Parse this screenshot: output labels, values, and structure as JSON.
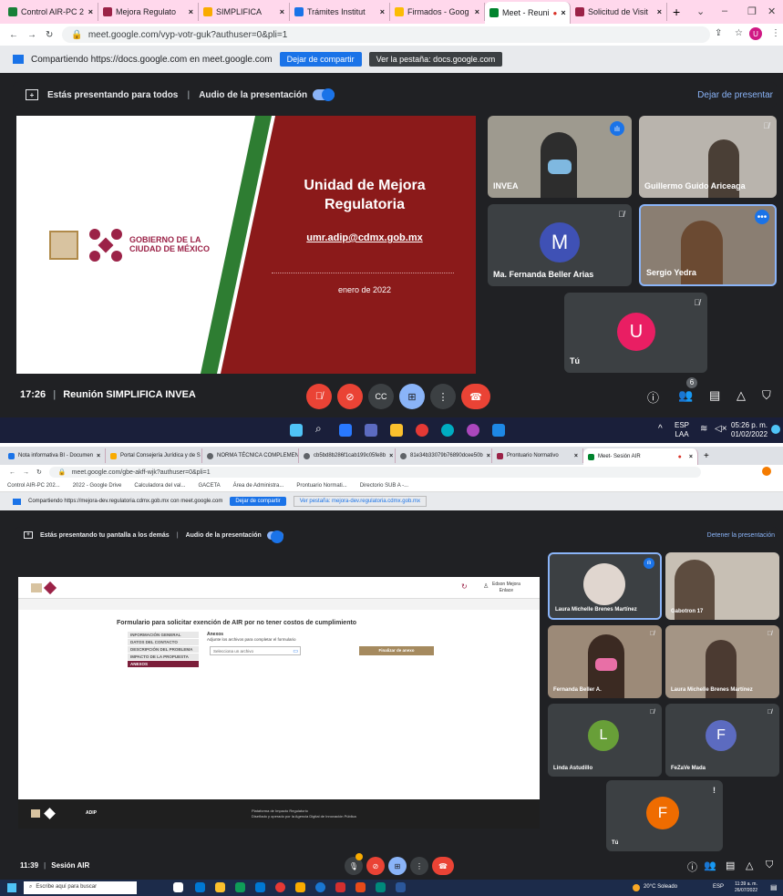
{
  "s1": {
    "tabs": [
      {
        "label": "Control AIR-PC 2",
        "color": "#188038"
      },
      {
        "label": "Mejora Regulato",
        "color": "#9b2247"
      },
      {
        "label": "SIMPLIFICA",
        "color": "#f9ab00"
      },
      {
        "label": "Trámites Institut",
        "color": "#1a73e8"
      },
      {
        "label": "Firmados - Goog",
        "color": "#fbbc04"
      },
      {
        "label": "Meet - Reuni",
        "color": "#00832d"
      },
      {
        "label": "Solicitud de Visit",
        "color": "#9b2247"
      }
    ],
    "url": "meet.google.com/vyp-votr-guk?authuser=0&pli=1",
    "profile_initial": "U",
    "share_text": "Compartiendo https://docs.google.com en meet.google.com",
    "stop_share": "Dejar de compartir",
    "view_tab": "Ver la pestaña: docs.google.com",
    "presenting": "Estás presentando para todos",
    "audio": "Audio de la presentación",
    "stop_presenting": "Dejar de presentar",
    "slide": {
      "gob_line1": "GOBIERNO DE LA",
      "gob_line2": "CIUDAD DE MÉXICO",
      "title": "Unidad de Mejora Regulatoria",
      "email": "umr.adip@cdmx.gob.mx",
      "date": "enero de 2022"
    },
    "participants": [
      {
        "name": "INVEA"
      },
      {
        "name": "Guillermo Guido Ariceaga"
      },
      {
        "name": "Ma. Fernanda Beller Arias",
        "initial": "M",
        "color": "#3f51b5"
      },
      {
        "name": "Sergio Yedra"
      },
      {
        "name": "Tú",
        "initial": "U",
        "color": "#e91e63"
      }
    ],
    "time": "17:26",
    "meeting": "Reunión SIMPLIFICA INVEA",
    "people_count": "6",
    "clock": "05:26 p. m.",
    "date": "01/02/2022",
    "lang": "ESP",
    "lang2": "LAA"
  },
  "s2": {
    "tabs": [
      {
        "label": "Nota informativa BI - Documen",
        "color": "#1a73e8"
      },
      {
        "label": "Portal Consejería Jurídica y de S",
        "color": "#f9ab00"
      },
      {
        "label": "NORMA TÉCNICA COMPLEMEN",
        "color": "#5f6368"
      },
      {
        "label": "cb5bd8b286f1cab199c05fe8b",
        "color": "#5f6368"
      },
      {
        "label": "81e34b33079b76890dcee50b",
        "color": "#5f6368"
      },
      {
        "label": "Prontuario Normativo",
        "color": "#9b2247"
      },
      {
        "label": "Meet- Sesión AIR",
        "color": "#00832d"
      }
    ],
    "url": "meet.google.com/gbe-akff-wjk?authuser=0&pli=1",
    "bookmarks": [
      "Control AIR-PC 202...",
      "2022 - Google Drive",
      "Calculadora del val...",
      "GACETA",
      "Área de Administra...",
      "Prontuario Normati...",
      "Directorio SUB A -..."
    ],
    "share_text": "Compartiendo https://mejora-dev.regulatoria.cdmx.gob.mx con meet.google.com",
    "stop_share": "Dejar de compartir",
    "view_tab": "Ver pestaña: mejora-dev.regulatoria.cdmx.gob.mx",
    "presenting": "Estás presentando tu pantalla a los demás",
    "audio": "Audio de la presentación",
    "stop_presenting": "Detener la presentación",
    "form": {
      "user": "Edson Mejora",
      "user_role": "Enlace",
      "title": "Formulario para solicitar exención de AIR por no tener costos de cumplimiento",
      "menu": [
        "INFORMACIÓN GENERAL",
        "DATOS DEL CONTACTO",
        "DESCRIPCIÓN DEL PROBLEMA",
        "IMPACTO DE LA PROPUESTA",
        "ANEXOS"
      ],
      "section": "Anexos",
      "hint": "Adjunte los archivos para completar el formulario",
      "file_placeholder": "Selecciona un archivo",
      "finish": "Finalizar de anexo",
      "footer_left": "ADIP",
      "footer_mid1": "Plataforma de Impacto Regulatorio",
      "footer_mid2": "Diseñado y operado por la Agencia Digital de Innovación Pública"
    },
    "participants": [
      {
        "name": "Laura Michelle Brenes Martínez"
      },
      {
        "name": "Gabotron 17"
      },
      {
        "name": "Fernanda Beller A."
      },
      {
        "name": "Laura Michelle Brenes Martínez"
      },
      {
        "name": "Linda Astudillo",
        "initial": "L",
        "color": "#689f38"
      },
      {
        "name": "FeZaVe Mada",
        "initial": "F",
        "color": "#5c6bc0"
      },
      {
        "name": "Tú",
        "initial": "F",
        "color": "#ef6c00"
      }
    ],
    "time": "11:39",
    "meeting": "Sesión AIR",
    "search": "Escribe aquí para buscar",
    "weather": "20°C Soleado",
    "clock": "11:39 a. m.",
    "date": "26/07/2022",
    "lang": "ESP"
  }
}
